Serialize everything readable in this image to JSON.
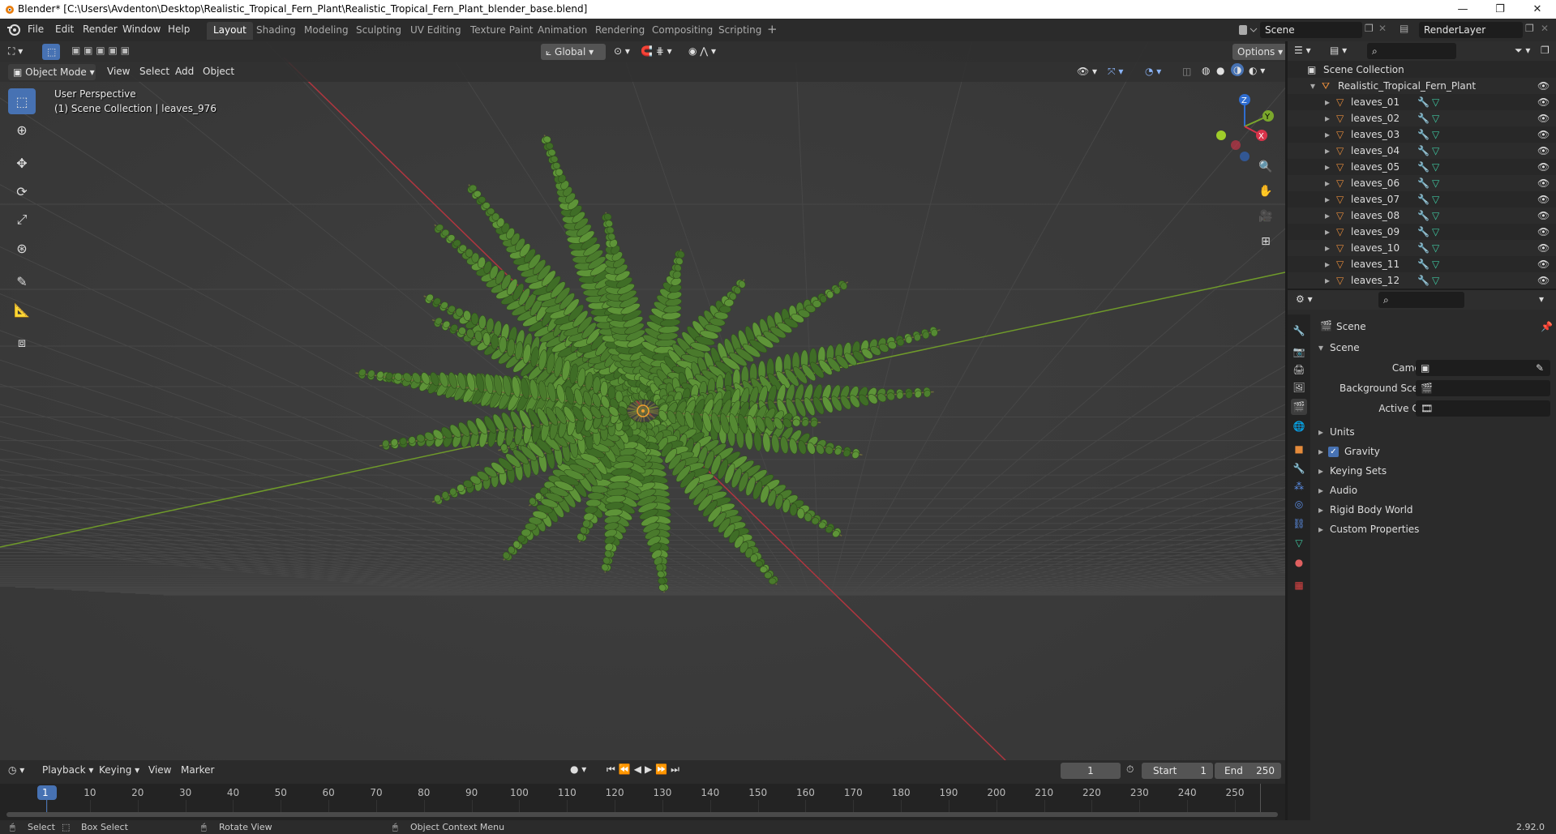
{
  "window": {
    "title": "Blender* [C:\\Users\\Avdenton\\Desktop\\Realistic_Tropical_Fern_Plant\\Realistic_Tropical_Fern_Plant_blender_base.blend]",
    "controls": [
      "—",
      "❐",
      "✕"
    ]
  },
  "menu": [
    "File",
    "Edit",
    "Render",
    "Window",
    "Help"
  ],
  "workspaces": [
    "Layout",
    "Shading",
    "Modeling",
    "Sculpting",
    "UV Editing",
    "Texture Paint",
    "Animation",
    "Rendering",
    "Compositing",
    "Scripting"
  ],
  "active_workspace": "Layout",
  "add_workspace": "+",
  "scene_field": "Scene",
  "view_layer_field": "RenderLayer",
  "viewport": {
    "mode": "Object Mode",
    "menus": [
      "View",
      "Select",
      "Add",
      "Object"
    ],
    "transform_orientation": "Global",
    "options_label": "Options",
    "overlay_line1": "User Perspective",
    "overlay_line2": "(1) Scene Collection | leaves_976",
    "gizmo_axes": {
      "z": "Z",
      "y": "Y",
      "x": "X"
    }
  },
  "timeline": {
    "menus": [
      "Playback",
      "Keying",
      "View",
      "Marker"
    ],
    "current_frame": "1",
    "start_label": "Start",
    "start_value": "1",
    "end_label": "End",
    "end_value": "250",
    "ticks": [
      "1",
      "10",
      "20",
      "30",
      "40",
      "50",
      "60",
      "70",
      "80",
      "90",
      "100",
      "110",
      "120",
      "130",
      "140",
      "150",
      "160",
      "170",
      "180",
      "190",
      "200",
      "210",
      "220",
      "230",
      "240",
      "250"
    ]
  },
  "statusbar": {
    "select": "Select",
    "box_select": "Box Select",
    "rotate_view": "Rotate View",
    "context_menu": "Object Context Menu",
    "version": "2.92.0"
  },
  "outliner": {
    "root": "Scene Collection",
    "collection": "Realistic_Tropical_Fern_Plant",
    "items": [
      "leaves_01",
      "leaves_02",
      "leaves_03",
      "leaves_04",
      "leaves_05",
      "leaves_06",
      "leaves_07",
      "leaves_08",
      "leaves_09",
      "leaves_10",
      "leaves_11",
      "leaves_12"
    ]
  },
  "properties": {
    "context": "Scene",
    "panel_title": "Scene",
    "camera_label": "Camera",
    "background_scene_label": "Background Scene",
    "active_clip_label": "Active Clip",
    "panels": [
      "Units",
      "Gravity",
      "Keying Sets",
      "Audio",
      "Rigid Body World",
      "Custom Properties"
    ],
    "gravity_checked": true
  },
  "colors": {
    "accent": "#4772b3",
    "axis_x": "#b0363f",
    "axis_y": "#6f9a2a",
    "fern_green": "#4f7d2f",
    "object_orange": "#e58b3b",
    "mesh_green": "#3fc7a0"
  }
}
